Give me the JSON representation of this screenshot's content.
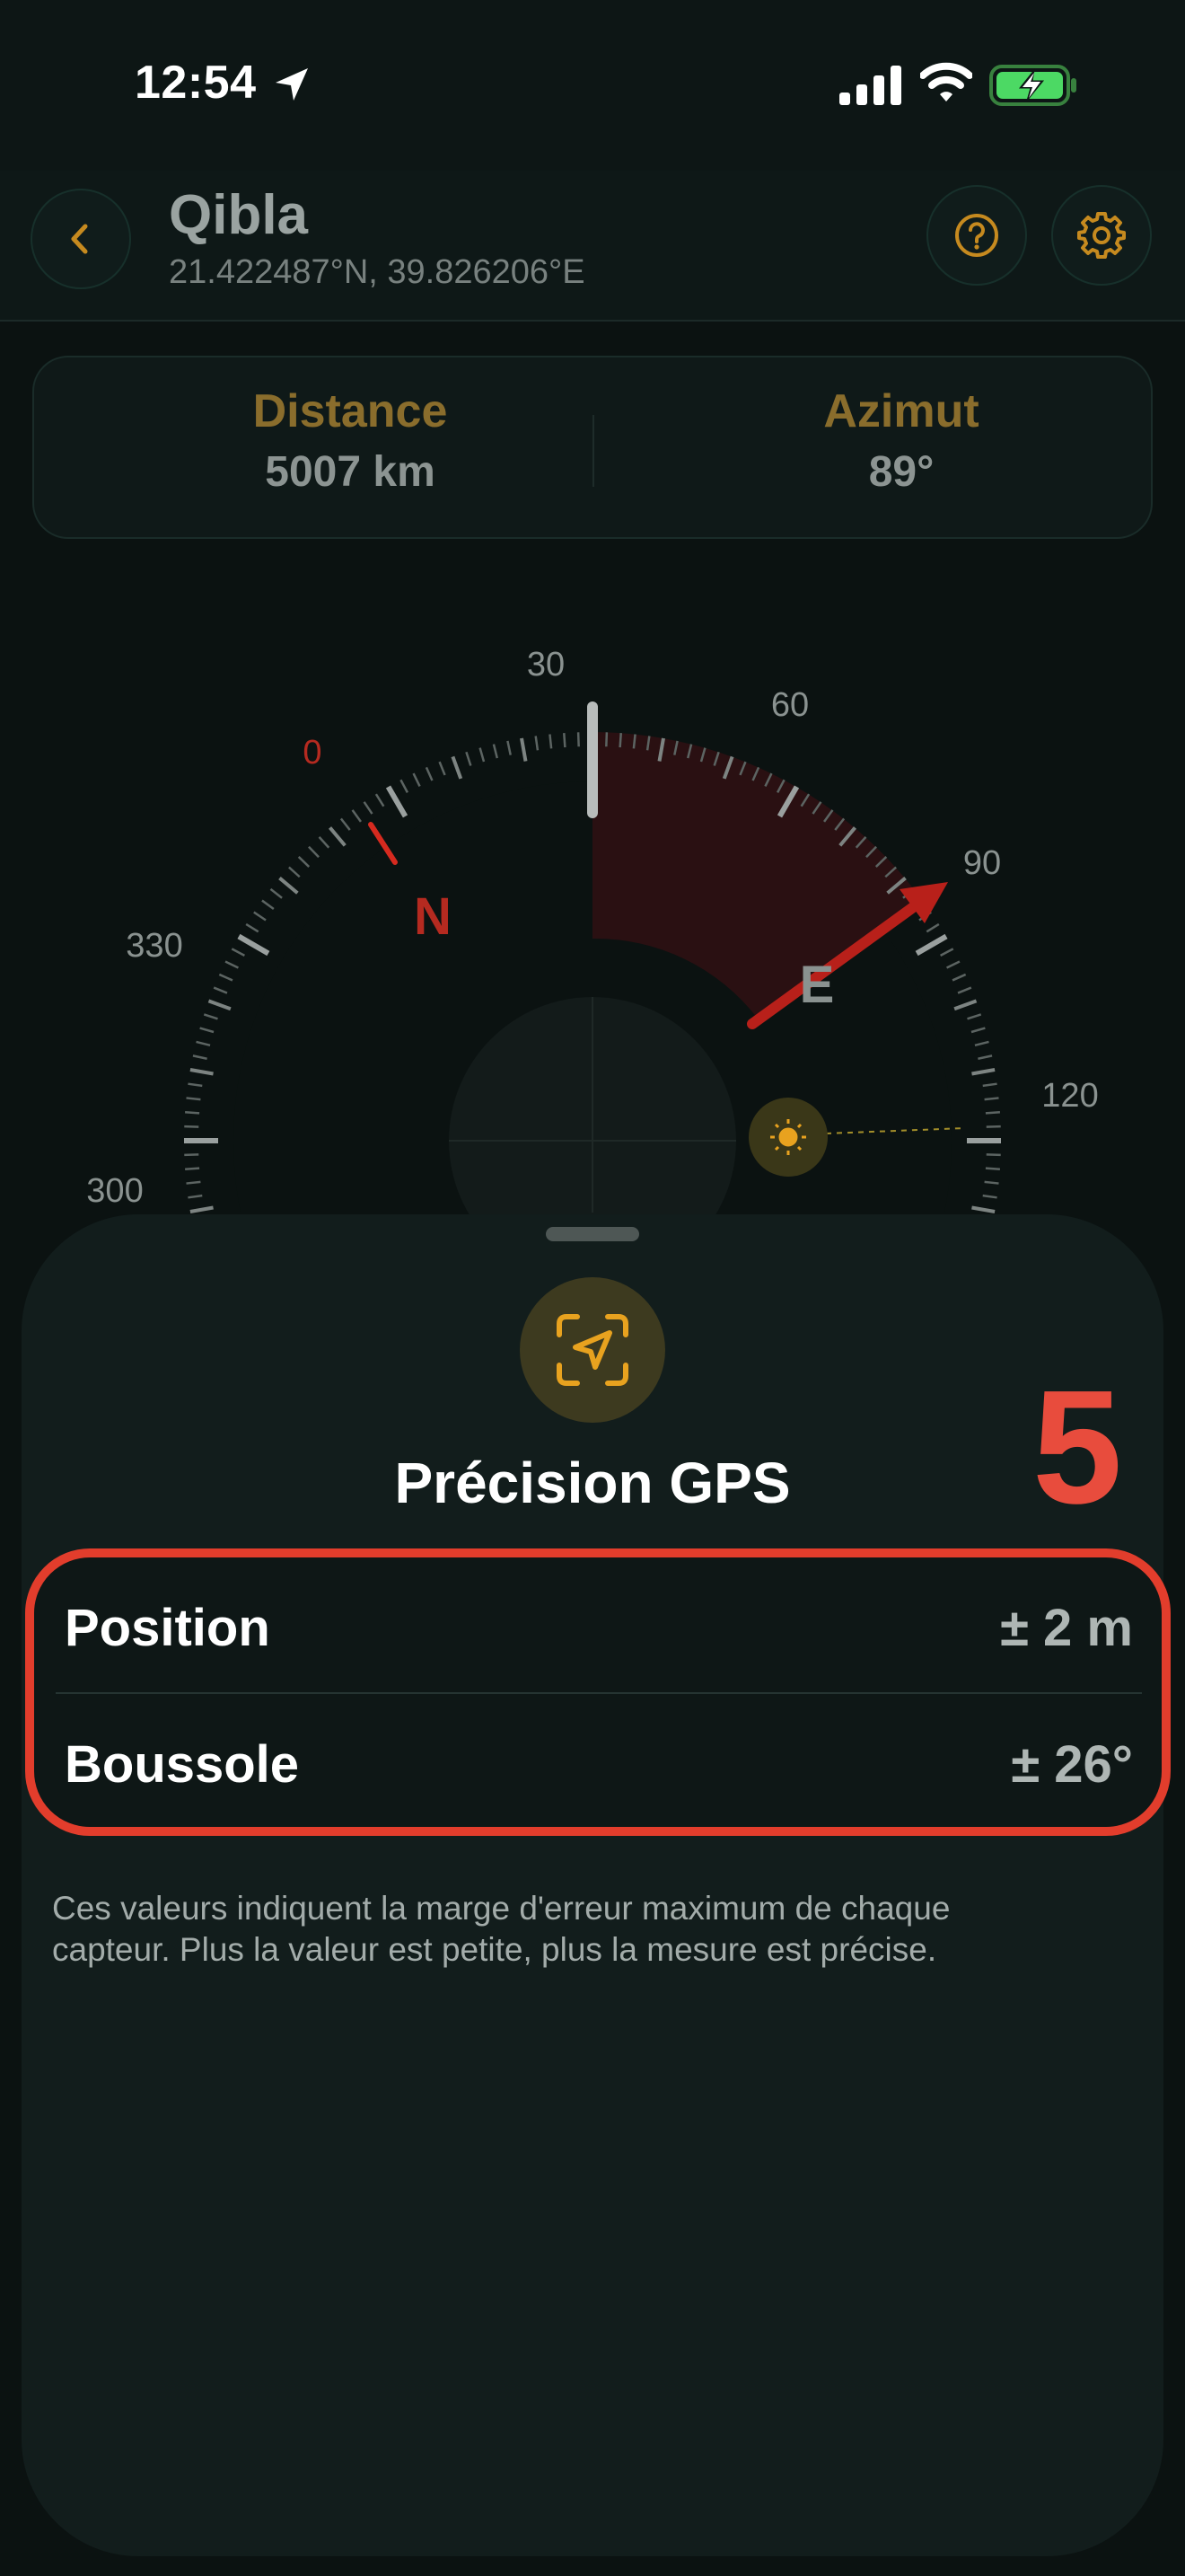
{
  "status_bar": {
    "time": "12:54",
    "icons": [
      "location-arrow-icon",
      "cellular-signal-icon",
      "wifi-icon",
      "battery-charging-icon"
    ]
  },
  "header": {
    "title": "Qibla",
    "coordinates": "21.422487°N, 39.826206°E",
    "icons": [
      "chevron-left-icon",
      "question-circle-icon",
      "gear-icon"
    ]
  },
  "info": {
    "distance_label": "Distance",
    "distance_value": "5007 km",
    "azimuth_label": "Azimut",
    "azimuth_value": "89°"
  },
  "compass": {
    "tick_labels": [
      "0",
      "30",
      "60",
      "90",
      "120",
      "300",
      "330"
    ],
    "cardinals": [
      "N",
      "E"
    ],
    "qibla_azimuth_deg": 89,
    "heading_deg": 30,
    "colors": {
      "accent": "#e8a21f",
      "danger": "#d62a1f",
      "qibla_sector": "#2a1012"
    }
  },
  "sheet": {
    "icon": "location-focus-icon",
    "title": "Précision GPS",
    "step_number": "5",
    "rows": [
      {
        "label": "Position",
        "value": "± 2 m"
      },
      {
        "label": "Boussole",
        "value": "± 26°"
      }
    ],
    "note": "Ces valeurs indiquent la marge d'erreur maximum de chaque capteur. Plus la valeur est petite, plus la mesure est précise.",
    "highlight_color": "#e23d2c"
  }
}
